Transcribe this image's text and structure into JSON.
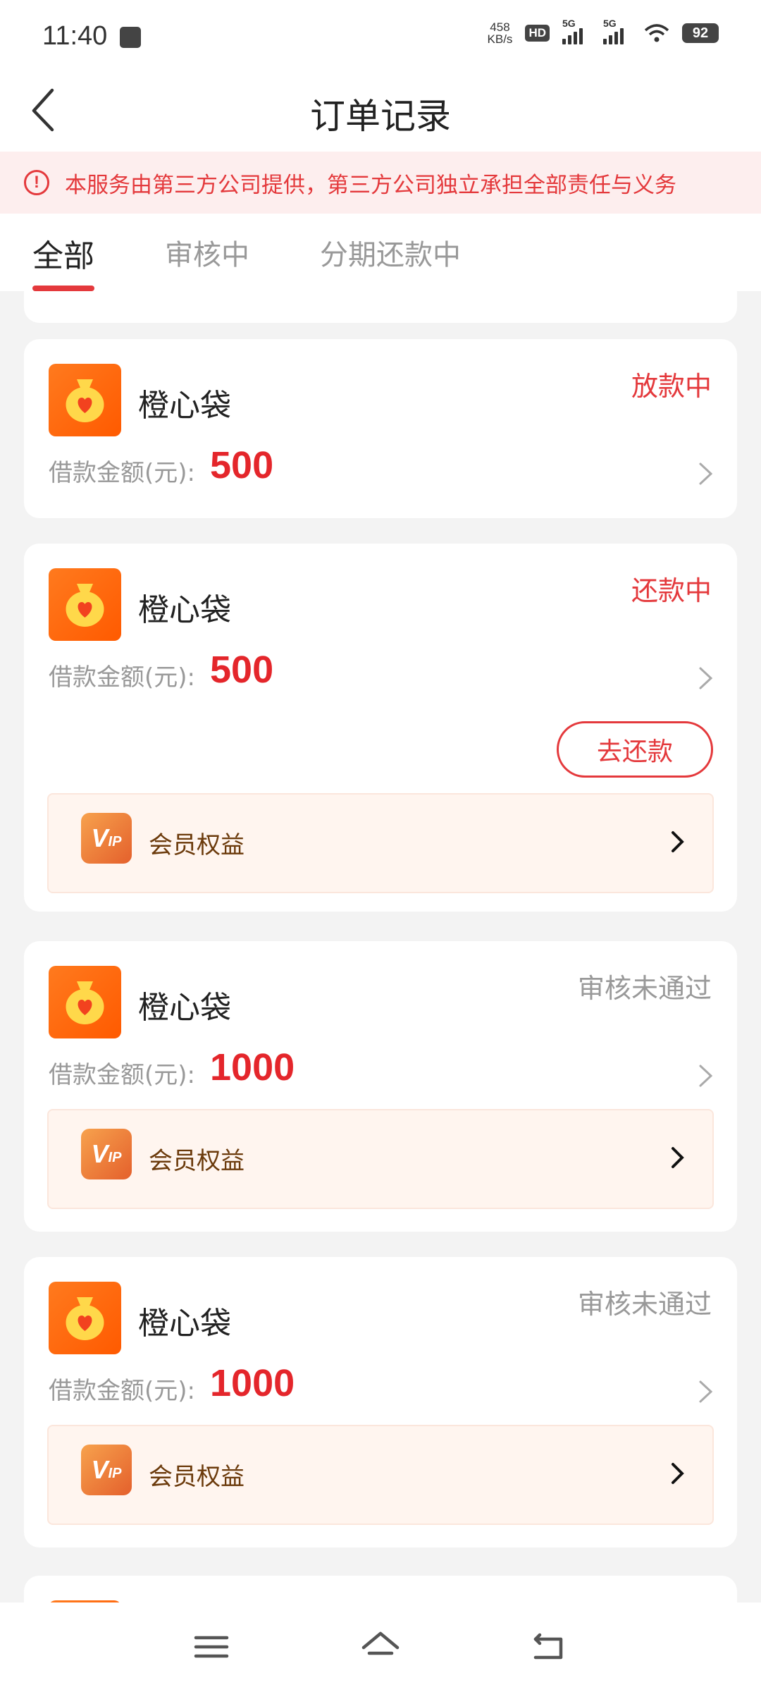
{
  "status_bar": {
    "time": "11:40",
    "net_speed_value": "458",
    "net_speed_unit": "KB/s",
    "hd_badge": "HD",
    "signal1_label": "5G",
    "signal2_label": "5G",
    "battery": "92"
  },
  "header": {
    "title": "订单记录"
  },
  "notice": {
    "text": "本服务由第三方公司提供，第三方公司独立承担全部责任与义务",
    "icon_text": "!"
  },
  "tabs": [
    {
      "label": "全部",
      "active": true
    },
    {
      "label": "审核中",
      "active": false
    },
    {
      "label": "分期还款中",
      "active": false
    }
  ],
  "orders": [
    {
      "app_name": "橙心袋",
      "status": "放款中",
      "amount_label": "借款金额(元):",
      "amount": "500"
    },
    {
      "app_name": "橙心袋",
      "status": "还款中",
      "amount_label": "借款金额(元):",
      "amount": "500",
      "action_label": "去还款",
      "vip_label": "会员权益"
    },
    {
      "app_name": "橙心袋",
      "status": "审核未通过",
      "amount_label": "借款金额(元):",
      "amount": "1000",
      "vip_label": "会员权益"
    },
    {
      "app_name": "橙心袋",
      "status": "审核未通过",
      "amount_label": "借款金额(元):",
      "amount": "1000",
      "vip_label": "会员权益"
    }
  ],
  "vip_logo_text": "V",
  "vip_logo_small": "IP",
  "colors": {
    "accent": "#e4393c",
    "amount": "#e4262b",
    "logo_orange": "#ff6a00",
    "vip_bg": "#fff5ef",
    "vip_text": "#6b3a0b"
  },
  "icons": {
    "back": "chevron-left-icon",
    "notice": "exclamation-circle-icon",
    "app_logo": "money-bag-heart-icon",
    "detail": "chevron-right-icon",
    "vip": "vip-badge-icon",
    "nav": [
      "menu-icon",
      "home-icon",
      "back-nav-icon"
    ]
  }
}
